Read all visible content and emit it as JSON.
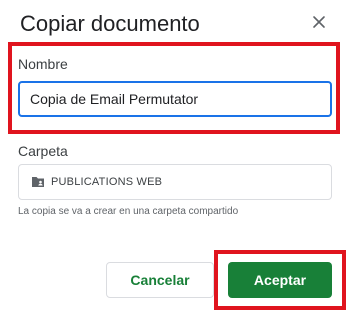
{
  "dialog": {
    "title": "Copiar documento",
    "close_icon": "close-icon"
  },
  "name_field": {
    "label": "Nombre",
    "value": "Copia de Email Permutator"
  },
  "folder_field": {
    "label": "Carpeta",
    "folder_icon": "shared-folder-icon",
    "folder_name": "PUBLICATIONS WEB",
    "helper_text": "La copia se va a crear en una carpeta compartido"
  },
  "actions": {
    "cancel_label": "Cancelar",
    "accept_label": "Aceptar"
  },
  "colors": {
    "primary_green": "#188038",
    "focus_blue": "#1a73e8",
    "highlight_red": "#e0141e"
  }
}
